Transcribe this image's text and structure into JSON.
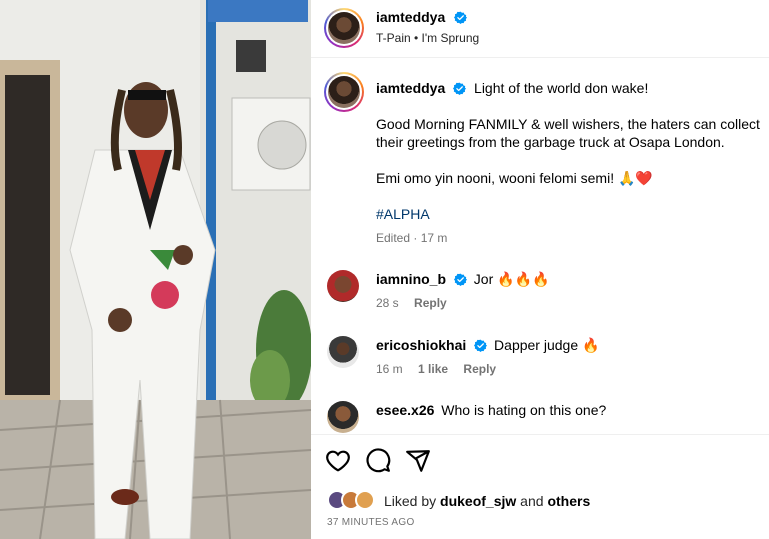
{
  "header": {
    "username": "iamteddya",
    "audio": "T-Pain • I'm Sprung"
  },
  "caption": {
    "username": "iamteddya",
    "first_line": "Light of the world don wake!",
    "para1": "Good Morning FANMILY & well wishers, the haters can collect their greetings from the garbage truck at Osapa London.",
    "para2": "Emi omo yin nooni, wooni felomi semi! 🙏❤️",
    "hashtag": "#ALPHA",
    "meta": "Edited · 17 m"
  },
  "comments": [
    {
      "username": "iamnino_b",
      "text": "Jor 🔥🔥🔥",
      "time": "28 s",
      "likes": "",
      "reply": "Reply"
    },
    {
      "username": "ericoshiokhai",
      "text": "Dapper judge 🔥",
      "time": "16 m",
      "likes": "1 like",
      "reply": "Reply"
    },
    {
      "username": "esee.x26",
      "text": "Who is hating on this one?",
      "time": "",
      "likes": "",
      "reply": ""
    }
  ],
  "actions": {
    "like_icon": "heart-icon",
    "comment_icon": "comment-icon",
    "share_icon": "share-icon"
  },
  "likes": {
    "prefix": "Liked by ",
    "user": "dukeof_sjw",
    "middle": " and ",
    "others": "others"
  },
  "timestamp": "37 MINUTES AGO",
  "colors": {
    "verified": "#0095f6",
    "hashtag": "#00376b",
    "muted": "#737373"
  }
}
